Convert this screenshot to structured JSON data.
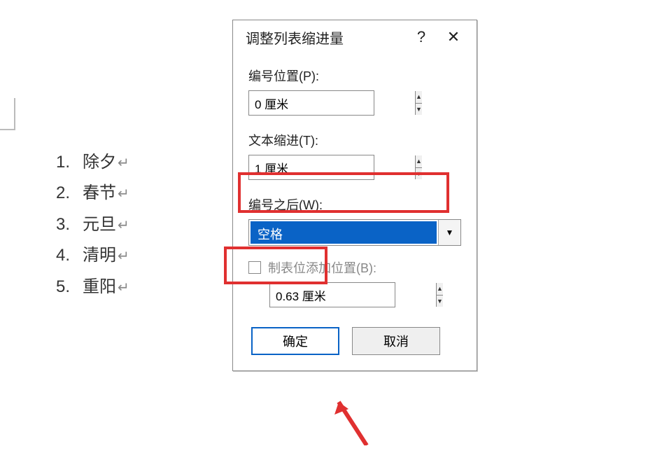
{
  "document": {
    "items": [
      {
        "num": "1.",
        "text": "除夕"
      },
      {
        "num": "2.",
        "text": "春节"
      },
      {
        "num": "3.",
        "text": "元旦"
      },
      {
        "num": "4.",
        "text": "清明"
      },
      {
        "num": "5.",
        "text": "重阳"
      }
    ],
    "return_glyph": "↵"
  },
  "dialog": {
    "title": "调整列表缩进量",
    "help": "?",
    "close": "✕",
    "number_position": {
      "label": "编号位置(P):",
      "value": "0 厘米"
    },
    "text_indent": {
      "label": "文本缩进(T):",
      "value": "1 厘米"
    },
    "after_number": {
      "label": "编号之后(W):",
      "value": "空格"
    },
    "tab_stop": {
      "checkbox_label": "制表位添加位置(B):",
      "value": "0.63 厘米"
    },
    "ok": "确定",
    "cancel": "取消"
  }
}
